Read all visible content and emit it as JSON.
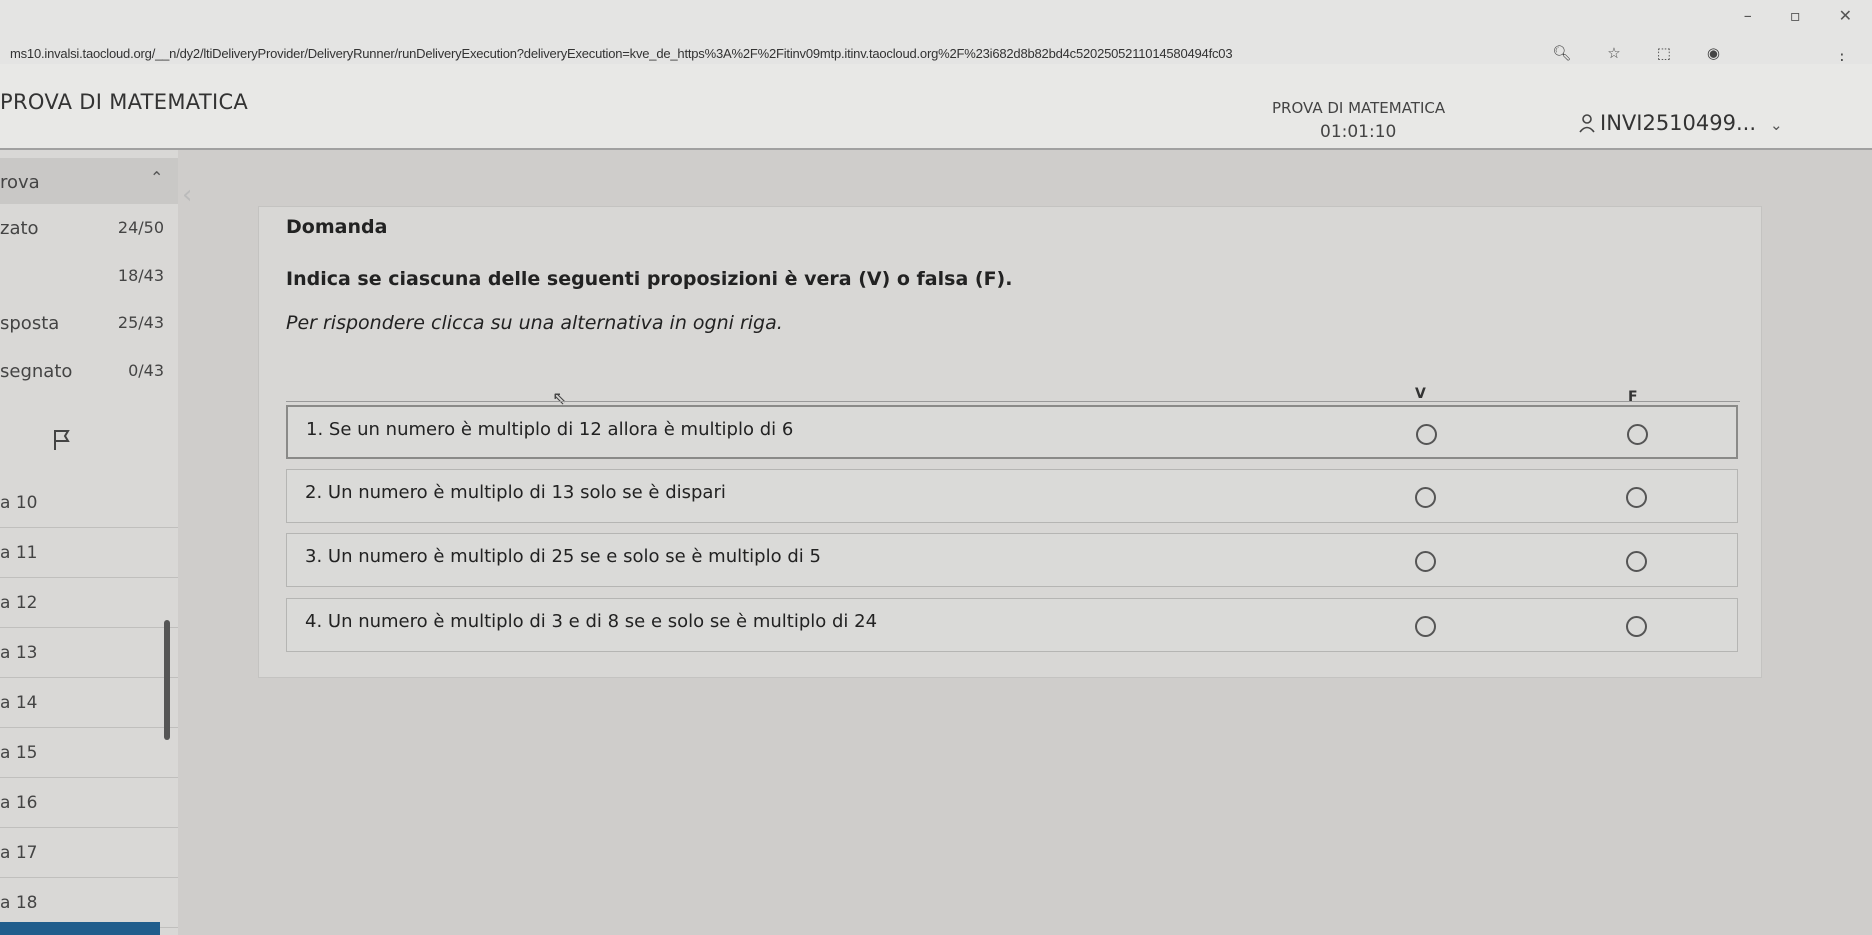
{
  "browser": {
    "url": "ms10.invalsi.taocloud.org/__n/dy2/ltiDeliveryProvider/DeliveryRunner/runDeliveryExecution?deliveryExecution=kve_de_https%3A%2F%2Fitinv09mtp.itinv.taocloud.org%2F%23i682d8b82bd4c52025052110145804​94fc03"
  },
  "header": {
    "title": "PROVA DI MATEMATICA",
    "center_title": "PROVA DI MATEMATICA",
    "timer": "01:01:10",
    "user": "INVI2510499..."
  },
  "sidebar": {
    "heading": "rova",
    "stats": [
      {
        "label": "zato",
        "value": "24/50"
      },
      {
        "label": "",
        "value": "18/43"
      },
      {
        "label": "sposta",
        "value": "25/43"
      },
      {
        "label": "segnato",
        "value": "0/43"
      }
    ],
    "items": [
      {
        "label": "a 10"
      },
      {
        "label": "a 11"
      },
      {
        "label": "a 12"
      },
      {
        "label": "a 13"
      },
      {
        "label": "a 14"
      },
      {
        "label": "a 15"
      },
      {
        "label": "a 16"
      },
      {
        "label": "a 17"
      },
      {
        "label": "a 18"
      }
    ]
  },
  "question": {
    "heading": "Domanda",
    "prompt": "Indica se ciascuna delle seguenti proposizioni è vera (V) o falsa (F).",
    "instruction": "Per rispondere clicca su una alternativa in ogni riga.",
    "col_v": "V",
    "col_f": "F",
    "rows": [
      {
        "text": "1. Se un numero è multiplo di 12  allora è multiplo di 6"
      },
      {
        "text": "2. Un numero è multiplo di 13  solo se è dispari"
      },
      {
        "text": "3. Un numero è multiplo di 25  se e solo se è multiplo di 5"
      },
      {
        "text": "4. Un numero è multiplo di 3  e di 8  se e solo se è multiplo di 24"
      }
    ]
  },
  "icons": {
    "user": "user-icon",
    "flag": "flag-icon",
    "chevron": "chevron-down-icon"
  }
}
